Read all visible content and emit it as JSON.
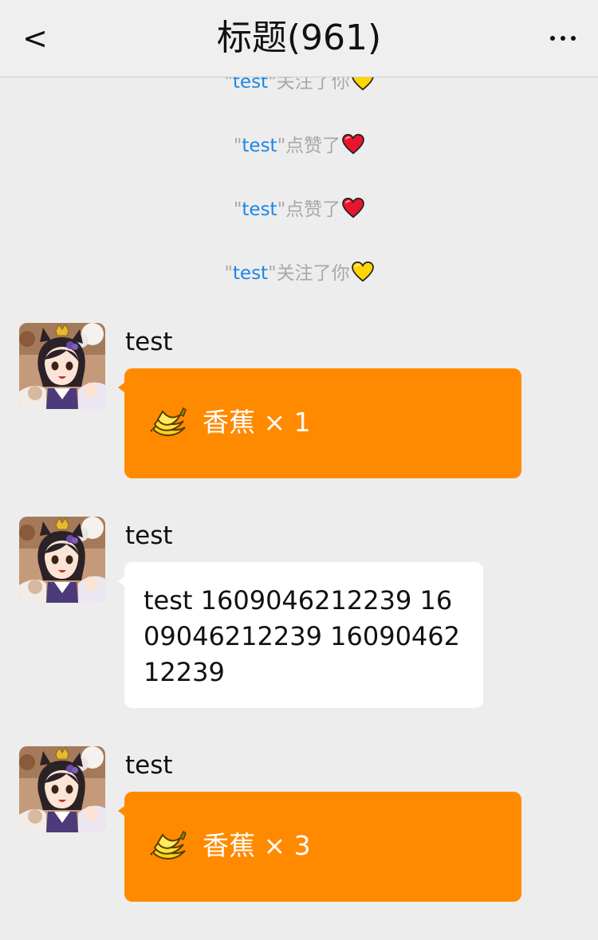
{
  "header": {
    "back_label": "<",
    "title": "标题(961)"
  },
  "system_messages": [
    {
      "q1": "\"",
      "user": "test",
      "q2": "\"",
      "action": "关注了你",
      "emoji": "yellow-heart"
    },
    {
      "q1": "\"",
      "user": "test",
      "q2": "\"",
      "action": "点赞了",
      "emoji": "red-heart"
    },
    {
      "q1": "\"",
      "user": "test",
      "q2": "\"",
      "action": "点赞了",
      "emoji": "red-heart"
    },
    {
      "q1": "\"",
      "user": "test",
      "q2": "\"",
      "action": "关注了你",
      "emoji": "yellow-heart"
    }
  ],
  "messages": [
    {
      "sender": "test",
      "type": "gift",
      "gift_icon": "banana-icon",
      "gift_text": "香蕉 × 1"
    },
    {
      "sender": "test",
      "type": "text",
      "text": "test 1609046212239 1609046212239 1609046212239"
    },
    {
      "sender": "test",
      "type": "gift",
      "gift_icon": "banana-icon",
      "gift_text": "香蕉 × 3"
    }
  ],
  "colors": {
    "background": "#ededed",
    "header": "#efefef",
    "username_link": "#1c86e8",
    "system_text": "#a8a8a8",
    "gift_bubble": "#ff8a00",
    "text_bubble": "#ffffff"
  }
}
